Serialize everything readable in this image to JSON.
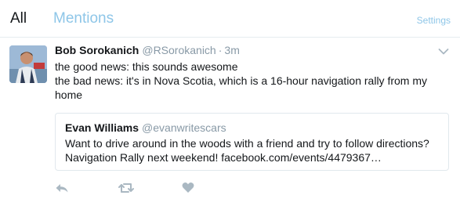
{
  "tabs": {
    "all_label": "All",
    "mentions_label": "Mentions",
    "settings_label": "Settings"
  },
  "colors": {
    "accent": "#8ec6e8",
    "muted": "#8899a6",
    "icon": "#aab8c2",
    "border": "#e1e8ed",
    "text": "#14171a"
  },
  "tweet": {
    "display_name": "Bob Sorokanich",
    "handle": "@RSorokanich",
    "separator": "·",
    "time": "3m",
    "lines": [
      "the good news: this sounds awesome",
      "the bad news: it's in Nova Scotia, which is a 16-hour navigation rally from my",
      "home"
    ],
    "quote": {
      "display_name": "Evan Williams",
      "handle": "@evanwritescars",
      "lines": [
        "Want to drive around in the woods with a friend and try to follow directions?",
        "Navigation Rally next weekend! facebook.com/events/4479367…"
      ]
    },
    "actions": [
      "reply-icon",
      "retweet-icon",
      "like-icon"
    ],
    "menu_icon": "chevron-down-icon",
    "avatar_icon": "avatar"
  }
}
